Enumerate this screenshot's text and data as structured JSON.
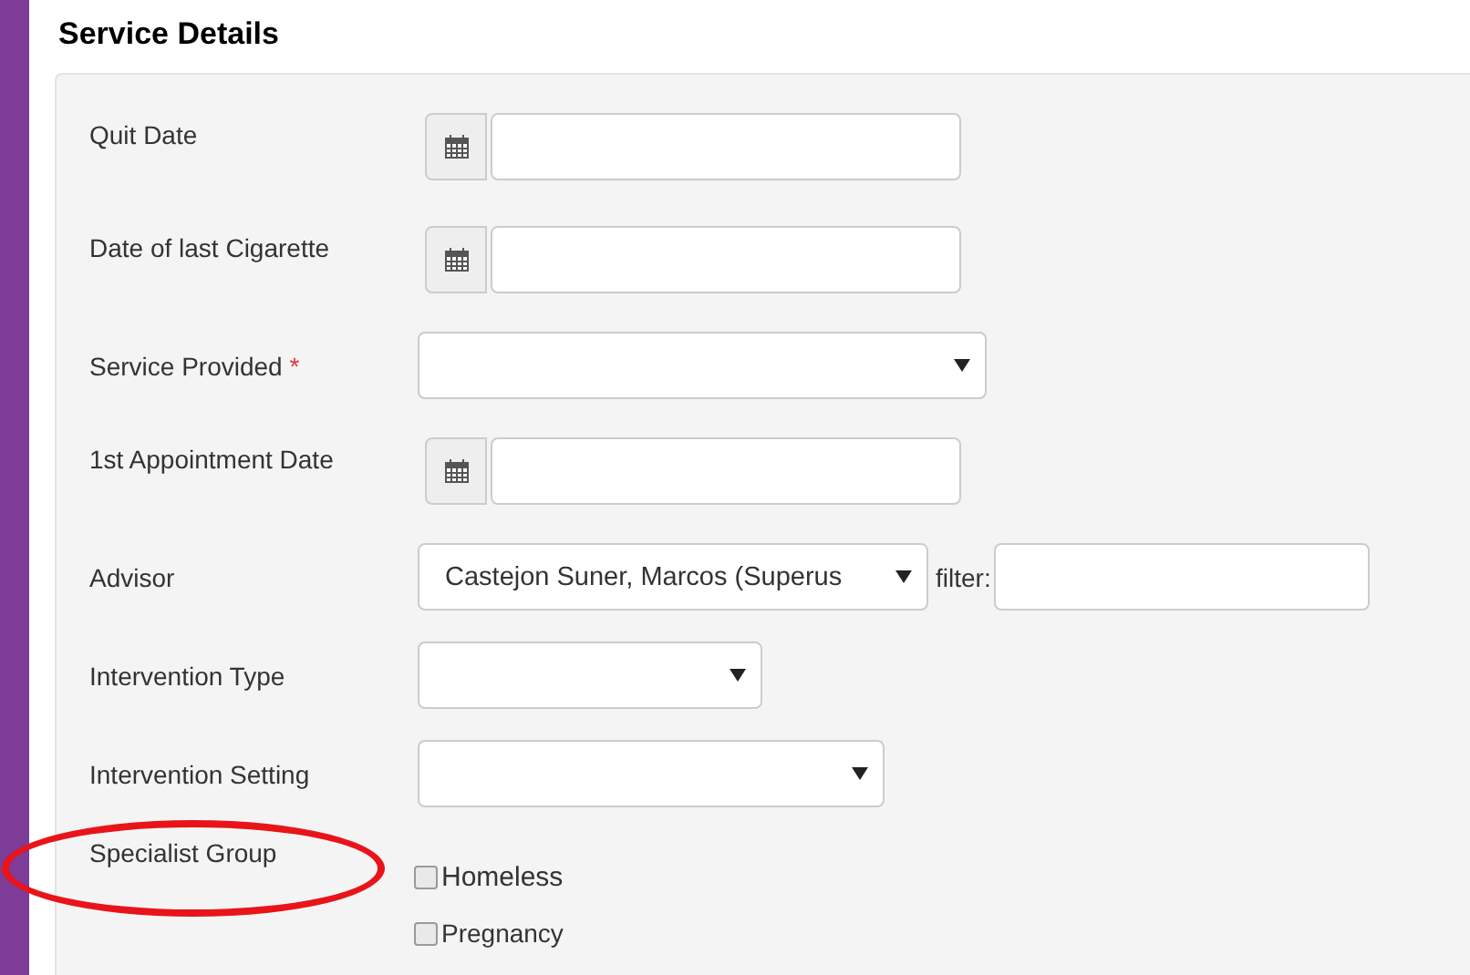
{
  "section_title": "Service Details",
  "fields": [
    {
      "kind": "date",
      "label": "Quit Date",
      "highlighted": false
    },
    {
      "kind": "date",
      "label": "Date of last Cigarette",
      "highlighted": false
    },
    {
      "kind": "select",
      "label": "Service Provided",
      "required_mark": "*",
      "highlighted": false
    },
    {
      "kind": "date",
      "label": "1st Appointment Date",
      "highlighted": false
    },
    {
      "kind": "select_filter",
      "label": "Advisor",
      "value": "Castejon Suner, Marcos (Superus",
      "filter_label": "filter:",
      "highlighted": false
    },
    {
      "kind": "select",
      "label": "Intervention Type",
      "highlighted": false
    },
    {
      "kind": "select",
      "label": "Intervention Setting",
      "highlighted": false
    },
    {
      "kind": "checkboxes",
      "label": "Specialist Group",
      "highlighted": true,
      "options": [
        {
          "label": "Homeless",
          "checked": false
        },
        {
          "label": "Pregnancy",
          "checked": false
        }
      ]
    }
  ]
}
